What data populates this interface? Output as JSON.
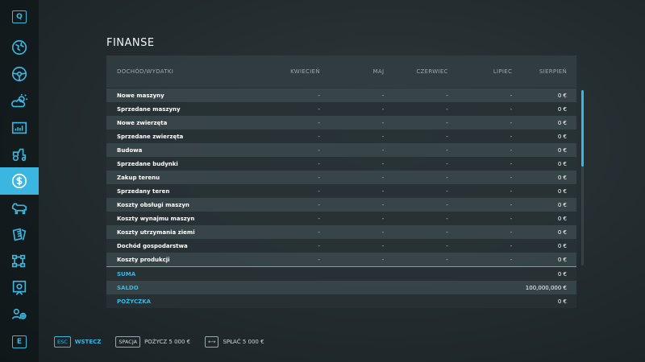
{
  "sidebar": {
    "top_key": "Q",
    "bottom_key": "E",
    "items": [
      {
        "icon": "globe-icon"
      },
      {
        "icon": "steering-wheel-icon"
      },
      {
        "icon": "weather-icon"
      },
      {
        "icon": "prices-chart-icon"
      },
      {
        "icon": "vehicles-icon"
      },
      {
        "icon": "finances-icon",
        "active": true
      },
      {
        "icon": "animals-icon"
      },
      {
        "icon": "contracts-icon"
      },
      {
        "icon": "production-icon"
      },
      {
        "icon": "statistics-icon"
      },
      {
        "icon": "workers-icon"
      }
    ]
  },
  "page": {
    "title": "FINANSE"
  },
  "table": {
    "headers": [
      "DOCHÓD/WYDATKI",
      "KWIECIEŃ",
      "MAJ",
      "CZERWIEC",
      "LIPIEC",
      "SIERPIEŃ"
    ],
    "rows": [
      {
        "label": "Nowe maszyny",
        "values": [
          "-",
          "-",
          "-",
          "-",
          "0 €"
        ]
      },
      {
        "label": "Sprzedane maszyny",
        "values": [
          "-",
          "-",
          "-",
          "-",
          "0 €"
        ]
      },
      {
        "label": "Nowe zwierzęta",
        "values": [
          "-",
          "-",
          "-",
          "-",
          "0 €"
        ]
      },
      {
        "label": "Sprzedane zwierzęta",
        "values": [
          "-",
          "-",
          "-",
          "-",
          "0 €"
        ]
      },
      {
        "label": "Budowa",
        "values": [
          "-",
          "-",
          "-",
          "-",
          "0 €"
        ]
      },
      {
        "label": "Sprzedane budynki",
        "values": [
          "-",
          "-",
          "-",
          "-",
          "0 €"
        ]
      },
      {
        "label": "Zakup terenu",
        "values": [
          "-",
          "-",
          "-",
          "-",
          "0 €"
        ]
      },
      {
        "label": "Sprzedany teren",
        "values": [
          "-",
          "-",
          "-",
          "-",
          "0 €"
        ]
      },
      {
        "label": "Koszty obsługi maszyn",
        "values": [
          "-",
          "-",
          "-",
          "-",
          "0 €"
        ]
      },
      {
        "label": "Koszty wynajmu maszyn",
        "values": [
          "-",
          "-",
          "-",
          "-",
          "0 €"
        ]
      },
      {
        "label": "Koszty utrzymania ziemi",
        "values": [
          "-",
          "-",
          "-",
          "-",
          "0 €"
        ]
      },
      {
        "label": "Dochód gospodarstwa",
        "values": [
          "-",
          "-",
          "-",
          "-",
          "0 €"
        ]
      },
      {
        "label": "Koszty produkcji",
        "values": [
          "-",
          "-",
          "-",
          "-",
          "0 €"
        ]
      }
    ],
    "summary": [
      {
        "label": "SUMA",
        "value": "0 €"
      },
      {
        "label": "SALDO",
        "value": "100,000,000 €"
      },
      {
        "label": "POŻYCZKA",
        "value": "0 €"
      }
    ]
  },
  "footer": {
    "back": {
      "key": "ESC",
      "label": "WSTECZ"
    },
    "borrow": {
      "key": "SPACJA",
      "label": "POŻYCZ 5 000 €"
    },
    "repay": {
      "key": "⟷",
      "label": "SPŁAĆ 5 000 €"
    }
  },
  "colors": {
    "accent": "#3bb6e0"
  }
}
